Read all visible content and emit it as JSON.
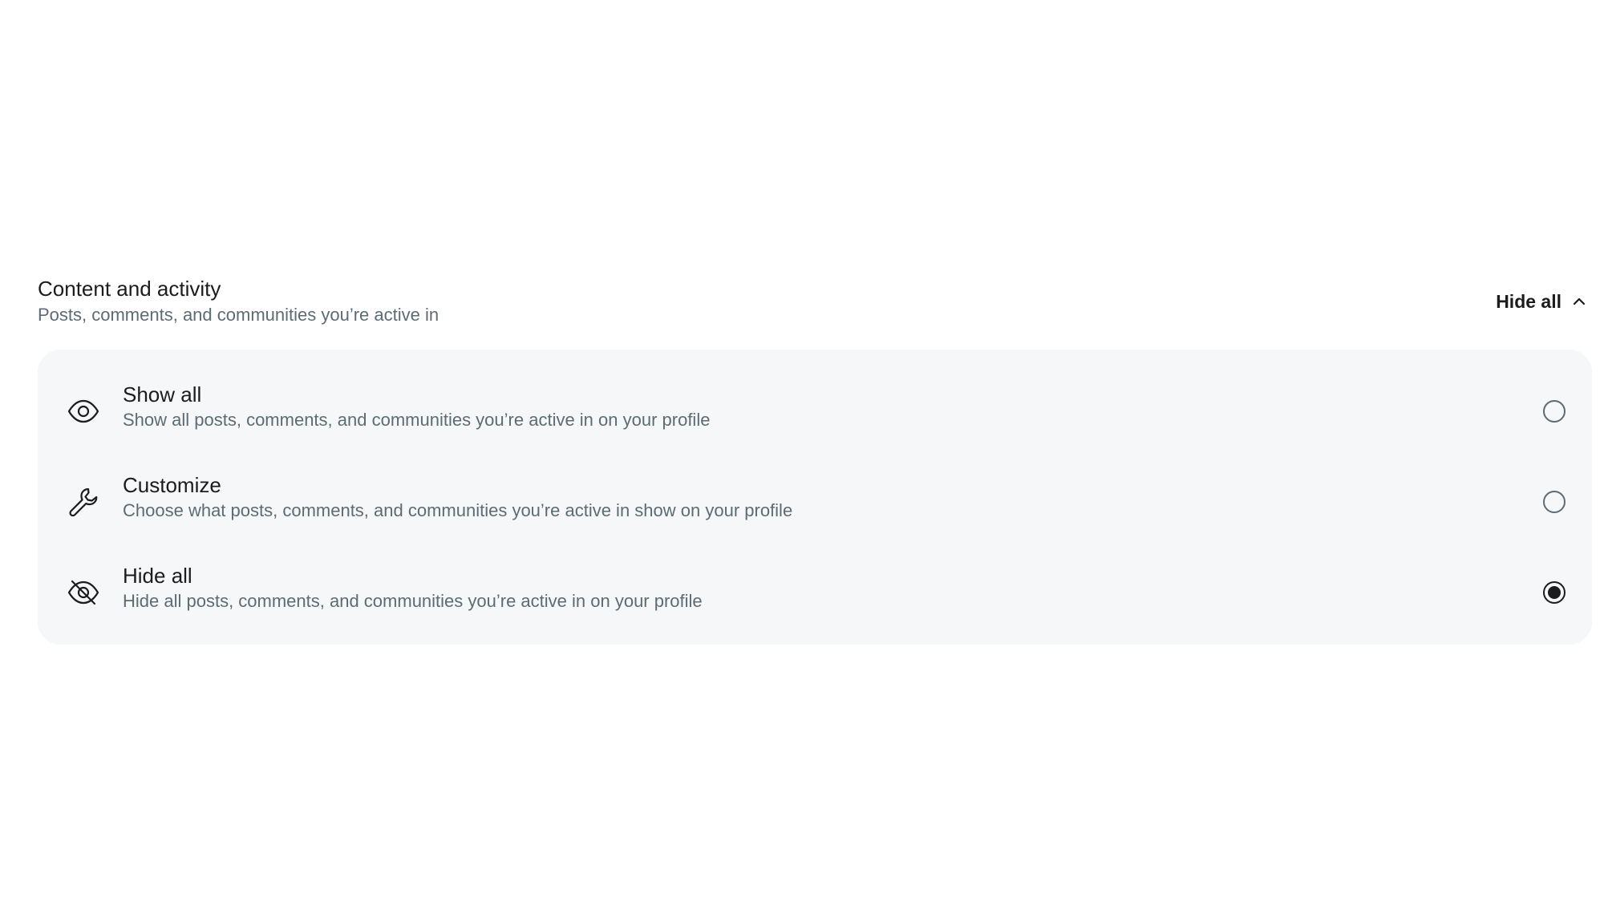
{
  "section": {
    "title": "Content and activity",
    "subtitle": "Posts, comments, and communities you’re active in",
    "toggle_label": "Hide all",
    "toggle_icon": "chevron-up-icon"
  },
  "options": [
    {
      "icon": "eye-icon",
      "label": "Show all",
      "description": "Show all posts, comments, and communities you’re active in on your profile",
      "selected": false
    },
    {
      "icon": "wrench-icon",
      "label": "Customize",
      "description": "Choose what posts, comments, and communities you’re active in show on your profile",
      "selected": false
    },
    {
      "icon": "eye-off-icon",
      "label": "Hide all",
      "description": "Hide all posts, comments, and communities you’re active in on your profile",
      "selected": true
    }
  ],
  "colors": {
    "card_background": "#f5f7f8",
    "primary_text": "#1c1c1c",
    "secondary_text": "#5c6c74"
  }
}
